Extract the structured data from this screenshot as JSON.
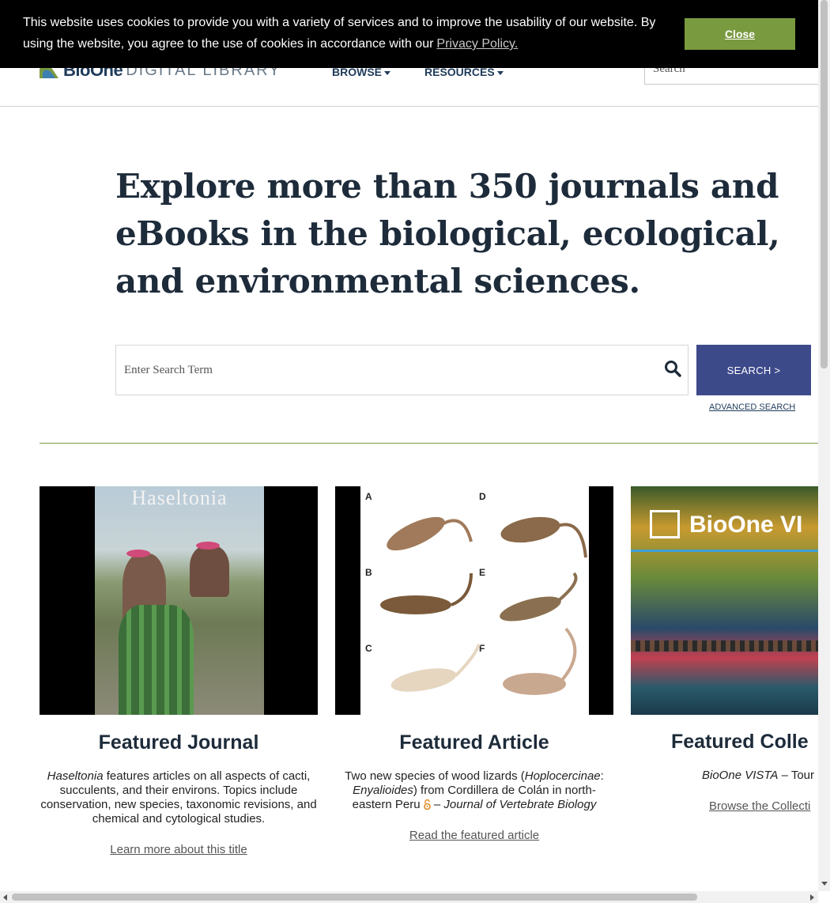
{
  "cookie": {
    "message": "This website uses cookies to provide you with a variety of services and to improve the usability of our website. By using the website, you agree to the use of cookies in accordance with our",
    "link_label": "Privacy Policy.",
    "close_label": "Close"
  },
  "header": {
    "logo_word": "BioOne",
    "logo_sub": "DIGITAL LIBRARY",
    "nav": [
      {
        "label": "BROWSE"
      },
      {
        "label": "RESOURCES"
      }
    ],
    "search_placeholder": "Search"
  },
  "hero": {
    "title": "Explore more than 350 journals and eBooks in the biological, ecological, and environmental sciences.",
    "search_placeholder": "Enter Search Term",
    "search_button": "SEARCH >",
    "advanced_label": "ADVANCED SEARCH"
  },
  "cards": [
    {
      "title": "Featured Journal",
      "desc_italic": "Haseltonia",
      "desc_rest": " features articles on all aspects of cacti, succulents, and their environs. Topics include conservation, new species, taxonomic revisions, and chemical and cytological studies.",
      "link": "Learn more about this title",
      "image_overlay": "Haseltonia"
    },
    {
      "title": "Featured Article",
      "desc_part1": "Two new species of wood lizards (",
      "desc_italic1": "Hoplocercinae",
      "desc_part2": ": ",
      "desc_italic2": "Enyalioides",
      "desc_part3": ") from Cordillera de Colán in north-eastern Peru",
      "desc_sep": " – ",
      "desc_journal": "Journal of Vertebrate Biology",
      "link": "Read the featured article",
      "panel_labels": [
        "A",
        "D",
        "B",
        "E",
        "C",
        "F"
      ]
    },
    {
      "title": "Featured Colle",
      "desc_italic": "BioOne VISTA",
      "desc_rest": " – Tour",
      "link": "Browse the Collecti",
      "image_overlay": "BioOne VI"
    }
  ],
  "colors": {
    "accent_green": "#7a9a3f",
    "button_blue": "#3d4a8a",
    "navy": "#1d2b3a"
  }
}
